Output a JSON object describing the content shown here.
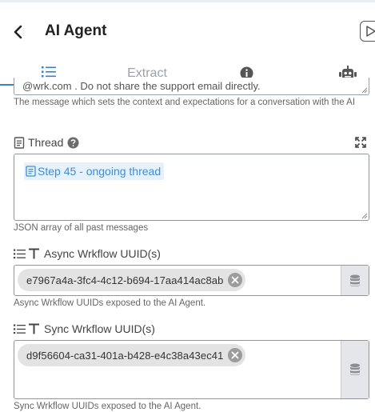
{
  "header": {
    "title": "AI Agent"
  },
  "tabs": {
    "extract_label": "Extract"
  },
  "system_message": {
    "value_visible": "@wrk.com . Do not share the support email directly.",
    "help": "The message which sets the context and expectations for a conversation with the AI"
  },
  "thread": {
    "label": "Thread",
    "chip": "Step 45 - ongoing thread",
    "help": "JSON array of all past messages"
  },
  "async": {
    "label": "Async Wrkflow UUID(s)",
    "chip": "e7967a4a-3fc4-4c12-b694-17aa414ac8ab",
    "help": "Async Wrkflow UUIDs exposed to the AI Agent."
  },
  "sync": {
    "label": "Sync Wrkflow UUID(s)",
    "chip": "d9f56604-ca31-401a-b428-e4c38a43ec41",
    "help": "Sync Wrkflow UUIDs exposed to the AI Agent."
  },
  "colors": {
    "accent": "#3b82c4",
    "chip_blue_bg": "#e6f1fb",
    "chip_blue_text": "#3d8fd6"
  },
  "icons": [
    "back-icon",
    "play-icon",
    "list-icon",
    "info-icon",
    "robot-icon",
    "document-icon",
    "help-icon",
    "expand-icon",
    "text-type-icon",
    "database-icon",
    "close-icon"
  ]
}
